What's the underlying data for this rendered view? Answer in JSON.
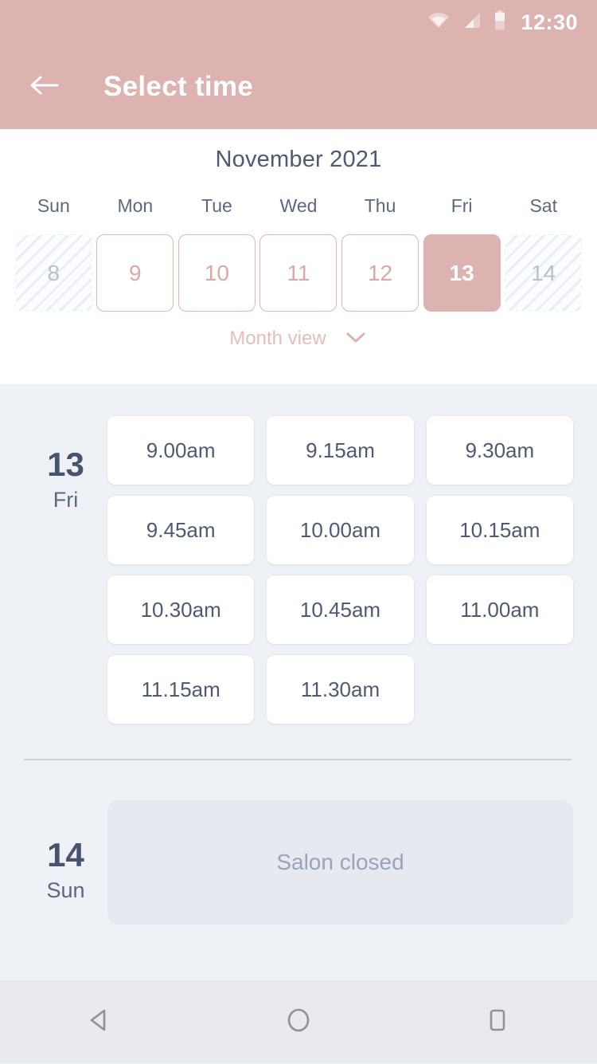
{
  "status_bar": {
    "time": "12:30",
    "icons": [
      "wifi-icon",
      "cell-signal-icon",
      "battery-icon"
    ]
  },
  "app_bar": {
    "back_icon": "arrow-left-icon",
    "title": "Select time"
  },
  "calendar": {
    "month_title": "November 2021",
    "weekday_headers": [
      "Sun",
      "Mon",
      "Tue",
      "Wed",
      "Thu",
      "Fri",
      "Sat"
    ],
    "days": [
      {
        "number": "8",
        "state": "disabled"
      },
      {
        "number": "9",
        "state": "available"
      },
      {
        "number": "10",
        "state": "available"
      },
      {
        "number": "11",
        "state": "available"
      },
      {
        "number": "12",
        "state": "available"
      },
      {
        "number": "13",
        "state": "selected"
      },
      {
        "number": "14",
        "state": "disabled"
      }
    ],
    "view_toggle": {
      "label": "Month view",
      "icon": "chevron-down-icon"
    }
  },
  "schedule": {
    "days": [
      {
        "day_number": "13",
        "day_name": "Fri",
        "slots": [
          "9.00am",
          "9.15am",
          "9.30am",
          "9.45am",
          "10.00am",
          "10.15am",
          "10.30am",
          "10.45am",
          "11.00am",
          "11.15am",
          "11.30am"
        ]
      },
      {
        "day_number": "14",
        "day_name": "Sun",
        "closed_message": "Salon closed"
      }
    ]
  },
  "nav_bar": {
    "back": "back-triangle-icon",
    "home": "home-circle-icon",
    "recents": "recents-square-icon"
  },
  "colors": {
    "accent_pink": "#dcb3b0",
    "accent_pink_light": "#e0b6b2",
    "text_dark": "#4e5a72",
    "surface": "#eef1f6",
    "closed_bg": "#e6eaf0"
  }
}
